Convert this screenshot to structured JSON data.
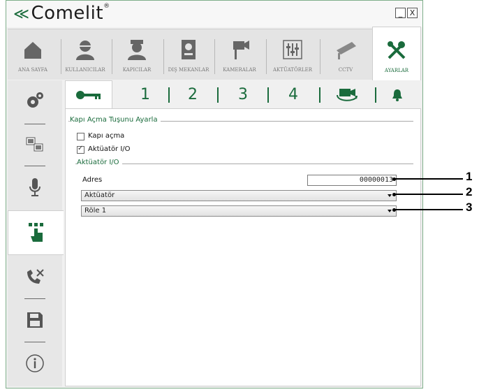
{
  "app": {
    "logo_text": "Comelit",
    "logo_mark": "≪",
    "registered": "®"
  },
  "window_controls": {
    "minimize": "_",
    "close": "X"
  },
  "nav": {
    "items": [
      {
        "label": "ANA SAYFA",
        "icon": "home-icon"
      },
      {
        "label": "KULLANICILAR",
        "icon": "user-icon"
      },
      {
        "label": "KAPICILAR",
        "icon": "doorman-icon"
      },
      {
        "label": "DIŞ MEKANLAR",
        "icon": "entrance-panel-icon"
      },
      {
        "label": "KAMERALAR",
        "icon": "camera-icon"
      },
      {
        "label": "AKTÜATÖRLER",
        "icon": "actuator-icon"
      },
      {
        "label": "CCTV",
        "icon": "cctv-icon"
      },
      {
        "label": "AYARLAR",
        "icon": "settings-tools-icon",
        "active": true
      }
    ]
  },
  "sidebar": {
    "items": [
      {
        "icon": "gears-icon"
      },
      {
        "icon": "network-icon"
      },
      {
        "icon": "microphone-icon"
      },
      {
        "icon": "touch-button-icon",
        "active": true
      },
      {
        "icon": "call-divert-icon"
      },
      {
        "icon": "save-icon"
      },
      {
        "icon": "info-icon"
      }
    ]
  },
  "tabs": {
    "items": [
      {
        "label": "",
        "icon": "key-icon",
        "active": true
      },
      {
        "label": "1"
      },
      {
        "label": "2"
      },
      {
        "label": "3"
      },
      {
        "label": "4"
      },
      {
        "label": "",
        "icon": "camera-cycle-icon"
      },
      {
        "label": "",
        "icon": "bell-icon"
      }
    ]
  },
  "form": {
    "group_title": "Kapı Açma Tuşunu Ayarla",
    "option1_label": "Kapı açma",
    "option1_checked": false,
    "option2_label": "Aktüatör I/O",
    "option2_checked": true,
    "subgroup_title": "Aktüatör I/O",
    "address_label": "Adres",
    "address_value": "00000013",
    "select1_value": "Aktüatör",
    "select2_value": "Röle 1"
  },
  "callouts": [
    "1",
    "2",
    "3"
  ],
  "colors": {
    "accent": "#1a6b3c",
    "border": "#7fae8a"
  }
}
